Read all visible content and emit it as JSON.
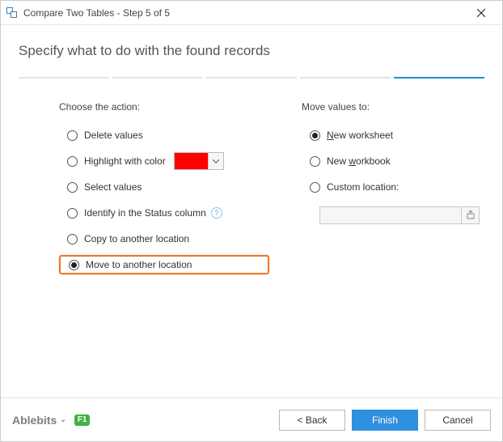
{
  "window": {
    "title": "Compare Two Tables - Step 5 of 5"
  },
  "heading": "Specify what to do with the found records",
  "left": {
    "title": "Choose the action:",
    "options": {
      "delete": "Delete values",
      "highlight": "Highlight with color",
      "select": "Select values",
      "identify": "Identify in the Status column",
      "copy": "Copy to another location",
      "move": "Move to another location"
    },
    "selected": "move",
    "highlight_color": "#fe0000"
  },
  "right": {
    "title": "Move values to:",
    "options": {
      "new_worksheet_prefix": "N",
      "new_worksheet_rest": "ew worksheet",
      "new_workbook_prefix": "New ",
      "new_workbook_underline": "w",
      "new_workbook_rest": "orkbook",
      "custom": "Custom location:"
    },
    "selected": "new_worksheet",
    "custom_value": ""
  },
  "footer": {
    "brand": "Ablebits",
    "help": "F1",
    "back": "< Back",
    "finish": "Finish",
    "cancel": "Cancel"
  }
}
